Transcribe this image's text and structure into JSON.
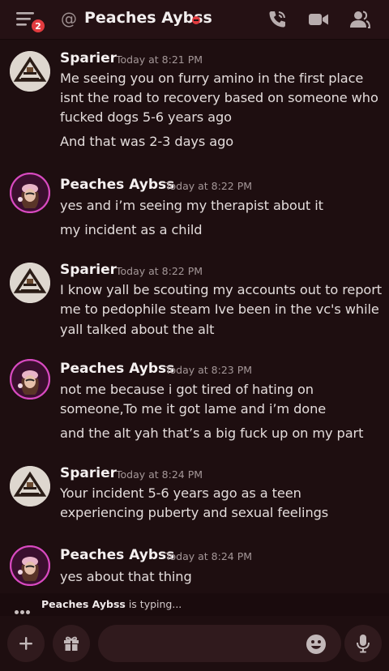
{
  "header": {
    "notification_count": "2",
    "at_symbol": "@",
    "channel_name": "Peaches Aybss",
    "icons": [
      "menu-icon",
      "call-icon",
      "video-icon",
      "members-icon"
    ]
  },
  "messages": [
    {
      "author": "Sparier",
      "timestamp": "Today at 8:21 PM",
      "lines": [
        "Me seeing you on furry amino in the first place",
        "isnt the road to recovery based on someone who",
        "fucked dogs 5-6 years ago",
        "And that was 2-3 days ago"
      ]
    },
    {
      "author": "Peaches Aybss",
      "timestamp": "Today at 8:22 PM",
      "lines": [
        "yes and i’m seeing my therapist about it",
        "my incident as a child"
      ]
    },
    {
      "author": "Sparier",
      "timestamp": "Today at 8:22 PM",
      "lines": [
        "I know yall be scouting my accounts out to report",
        "me to pedophile steam Ive been in the vc's while",
        "yall talked about the alt"
      ]
    },
    {
      "author": "Peaches Aybss",
      "timestamp": "Today at 8:23 PM",
      "lines": [
        "not me because i got tired of hating on",
        "someone,To me it got lame and i’m done",
        "and the alt yah that’s a big fuck up on my part"
      ]
    },
    {
      "author": "Sparier",
      "timestamp": "Today at 8:24 PM",
      "lines": [
        "Your incident 5-6 years ago as a teen",
        "experiencing puberty and sexual feelings"
      ]
    },
    {
      "author": "Peaches Aybss",
      "timestamp": "Today at 8:24 PM",
      "lines": [
        "yes about that thing"
      ]
    }
  ],
  "typing": {
    "user": "Peaches Aybss",
    "suffix": " is typing..."
  },
  "composer": {
    "icons": [
      "plus-icon",
      "gift-icon",
      "emoji-icon",
      "microphone-icon"
    ]
  },
  "colors": {
    "background": "#1e0e10",
    "header": "#251114",
    "badge": "#e23b3f",
    "input": "#301a1d"
  }
}
